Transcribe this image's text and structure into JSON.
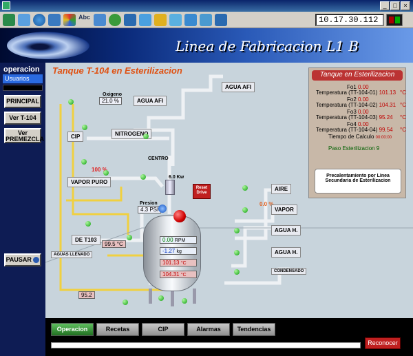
{
  "window": {
    "title": ""
  },
  "toolbar": {
    "ip": "10.17.30.112"
  },
  "banner": {
    "title": "Linea de Fabricacion L1 B"
  },
  "sidebar": {
    "section": "operacion",
    "usuarios": "Usuarios",
    "principal": "PRINCIPAL",
    "ver_t104": "Ver T-104",
    "ver_premezcla_1": "Ver",
    "ver_premezcla_2": "PREMEZCLA",
    "pausar": "PAUSAR"
  },
  "main": {
    "title": "Tanque T-104 en Esterilizacion",
    "tags": {
      "oxigeno": "Oxigeno",
      "oxigeno_val": "21.0 %",
      "agua_afi_1": "AGUA AFI",
      "agua_afi_2": "AGUA AFI",
      "cip": "CIP",
      "nitrogeno": "NITROGENO",
      "vapor_puro": "VAPOR PURO",
      "de_t103": "DE T103",
      "aire": "AIRE",
      "vapor": "VAPOR",
      "agua_h_1": "AGUA H.",
      "agua_h_2": "AGUA H.",
      "condensado": "CONDENSADO",
      "centro": "CENTRO",
      "aguas_llenado": "AGUAS LLENADO",
      "presion": "Presion",
      "presion_val": "4.3 PSI",
      "pct_100": "100 %",
      "pct_0": "0.0 %",
      "temp_left": "99.5 °C",
      "val_95": "95.2",
      "kw": "6.0 Kw",
      "reset": "Reset Drive"
    },
    "tank": {
      "rpm_val": "0.00",
      "rpm_unit": "RPM",
      "kg_val": "-1.27",
      "kg_unit": "kg",
      "t1_val": "101.13",
      "t1_unit": "°C",
      "t2_val": "104.31",
      "t2_unit": "°C"
    }
  },
  "info": {
    "title": "Tanque en Esterilizacion",
    "rows": [
      {
        "label": "Fo1",
        "value": "0.00",
        "unit": ""
      },
      {
        "label": "Temperatura (TT-104-01)",
        "value": "101.13",
        "unit": "°C"
      },
      {
        "label": "Fo2",
        "value": "0.00",
        "unit": ""
      },
      {
        "label": "Temperatura (TT-104-02)",
        "value": "104.31",
        "unit": "°C"
      },
      {
        "label": "Fo3",
        "value": "0.00",
        "unit": ""
      },
      {
        "label": "Temperatura (TT-104-03)",
        "value": "95.24",
        "unit": "°C"
      },
      {
        "label": "Fo4",
        "value": "0.00",
        "unit": ""
      },
      {
        "label": "Temperatura (TT-104-04)",
        "value": "99.54",
        "unit": "°C"
      }
    ],
    "tiempo_label": "Tiempo de Calculo",
    "tiempo_val": "00:00:00",
    "paso": "Paso Esterilizacion 9",
    "msg_1": "Precalentamiento por Linea",
    "msg_2": "Secundaria de Esterilizacion"
  },
  "bottom": {
    "tabs": [
      "Operacion",
      "Recetas",
      "CIP",
      "Alarmas",
      "Tendencias"
    ],
    "reconectar": "Reconocer"
  }
}
